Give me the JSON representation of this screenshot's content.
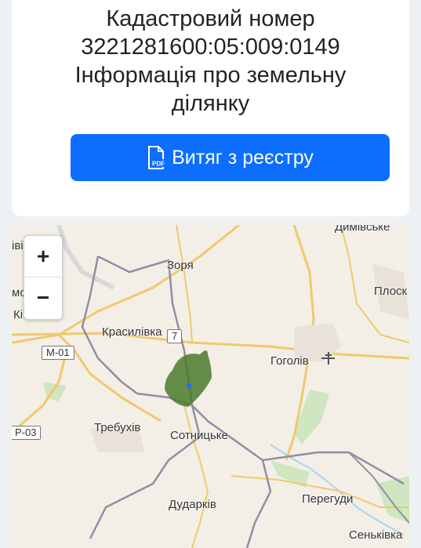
{
  "header": {
    "line1": "Кадастровий номер",
    "line2": "3221281600:05:009:0149",
    "line3": "Інформація про земельну",
    "line4": "ділянку"
  },
  "extract_button": {
    "label": "Витяг з реєстру",
    "icon_text": "PDF",
    "color": "#0d6efd"
  },
  "map": {
    "zoom_in": "+",
    "zoom_out": "−",
    "labels": {
      "dymivske": "Димівське",
      "zorya": "Зоря",
      "ploske": "Плоск",
      "krasylivka": "Красилівка",
      "hoholiv": "Гоголів",
      "trebukhiv": "Требухів",
      "sotnytske": "Сотницьке",
      "perehudy": "Перегуди",
      "kudarkiv": "Дударків",
      "senkivka": "Сеньківка",
      "partial_top_left": "іві",
      "partial_mid_left": "мо",
      "partial_k": "Кі"
    },
    "road_shields": {
      "m01": "М-01",
      "r03": "Р-03",
      "partial_7": "7"
    },
    "parcel_color": "#4a7a2a",
    "marker_color": "#1a6cff"
  }
}
